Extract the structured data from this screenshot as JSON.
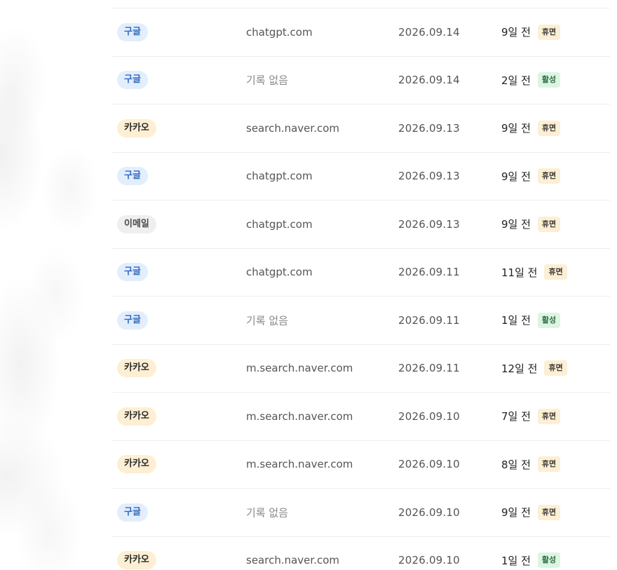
{
  "colors": {
    "google_badge_bg": "#e3eefc",
    "google_badge_text": "#2f69c8",
    "kakao_badge_bg": "#fcefd3",
    "email_badge_bg": "#efefef",
    "dormant_badge_bg": "#fcefd3",
    "active_badge_bg": "#dcf5e3",
    "active_badge_text": "#2e6b3f"
  },
  "rows": [
    {
      "provider": "구글",
      "provider_type": "google",
      "referrer": "chatgpt.com",
      "referrer_empty": false,
      "date": "2026.09.14",
      "last_activity": "9일 전",
      "status": "휴면",
      "status_type": "dormant"
    },
    {
      "provider": "구글",
      "provider_type": "google",
      "referrer": "기록 없음",
      "referrer_empty": true,
      "date": "2026.09.14",
      "last_activity": "2일 전",
      "status": "활성",
      "status_type": "active"
    },
    {
      "provider": "카카오",
      "provider_type": "kakao",
      "referrer": "search.naver.com",
      "referrer_empty": false,
      "date": "2026.09.13",
      "last_activity": "9일 전",
      "status": "휴면",
      "status_type": "dormant"
    },
    {
      "provider": "구글",
      "provider_type": "google",
      "referrer": "chatgpt.com",
      "referrer_empty": false,
      "date": "2026.09.13",
      "last_activity": "9일 전",
      "status": "휴면",
      "status_type": "dormant"
    },
    {
      "provider": "이메일",
      "provider_type": "email",
      "referrer": "chatgpt.com",
      "referrer_empty": false,
      "date": "2026.09.13",
      "last_activity": "9일 전",
      "status": "휴면",
      "status_type": "dormant"
    },
    {
      "provider": "구글",
      "provider_type": "google",
      "referrer": "chatgpt.com",
      "referrer_empty": false,
      "date": "2026.09.11",
      "last_activity": "11일 전",
      "status": "휴면",
      "status_type": "dormant"
    },
    {
      "provider": "구글",
      "provider_type": "google",
      "referrer": "기록 없음",
      "referrer_empty": true,
      "date": "2026.09.11",
      "last_activity": "1일 전",
      "status": "활성",
      "status_type": "active"
    },
    {
      "provider": "카카오",
      "provider_type": "kakao",
      "referrer": "m.search.naver.com",
      "referrer_empty": false,
      "date": "2026.09.11",
      "last_activity": "12일 전",
      "status": "휴면",
      "status_type": "dormant"
    },
    {
      "provider": "카카오",
      "provider_type": "kakao",
      "referrer": "m.search.naver.com",
      "referrer_empty": false,
      "date": "2026.09.10",
      "last_activity": "7일 전",
      "status": "휴면",
      "status_type": "dormant"
    },
    {
      "provider": "카카오",
      "provider_type": "kakao",
      "referrer": "m.search.naver.com",
      "referrer_empty": false,
      "date": "2026.09.10",
      "last_activity": "8일 전",
      "status": "휴면",
      "status_type": "dormant"
    },
    {
      "provider": "구글",
      "provider_type": "google",
      "referrer": "기록 없음",
      "referrer_empty": true,
      "date": "2026.09.10",
      "last_activity": "9일 전",
      "status": "휴면",
      "status_type": "dormant"
    },
    {
      "provider": "카카오",
      "provider_type": "kakao",
      "referrer": "search.naver.com",
      "referrer_empty": false,
      "date": "2026.09.10",
      "last_activity": "1일 전",
      "status": "활성",
      "status_type": "active"
    }
  ]
}
